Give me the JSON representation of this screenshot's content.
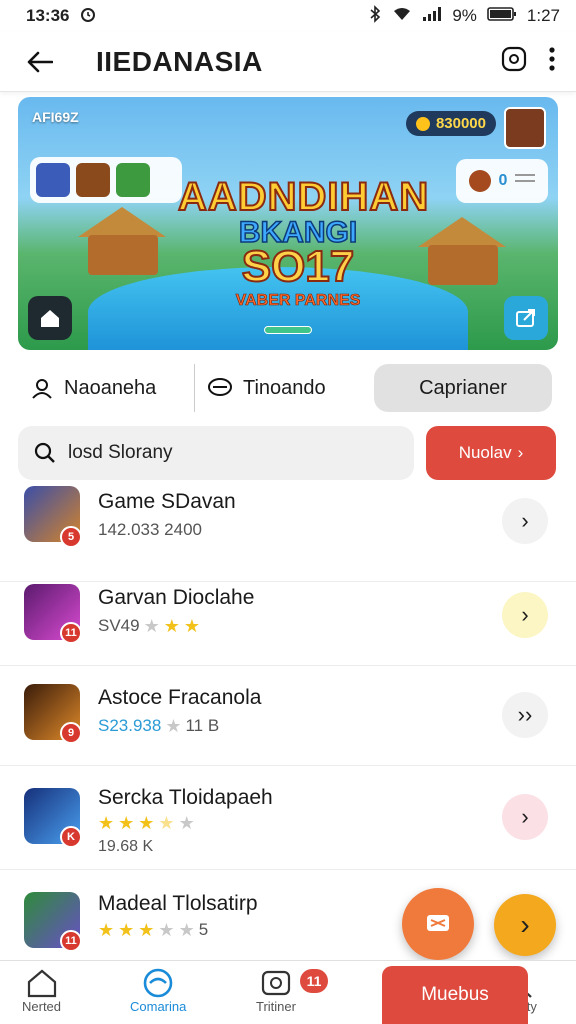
{
  "status_bar": {
    "time": "13:36",
    "battery": "9%",
    "right_time": "1:27"
  },
  "app_bar": {
    "title": "IIEDANASIA"
  },
  "banner": {
    "tag": "AFI69Z",
    "coins": "830000",
    "right_pill_count": "0",
    "logo_line1": "AADNDIHAN",
    "logo_line2": "BKANGI",
    "logo_line3": "SO17",
    "logo_line4": "VABER PARNES"
  },
  "tabs": [
    {
      "label": "Naoaneha"
    },
    {
      "label": "Tinoando"
    },
    {
      "label": "Caprianer"
    }
  ],
  "search": {
    "value": "losd Slorany",
    "filter_label": "Nuolav"
  },
  "games": [
    {
      "name": "Game SDavan",
      "meta": "142.033 2400",
      "badge": "5",
      "colors": [
        "#3a4ea8",
        "#d4842a"
      ],
      "go_color": "#f2f2f2"
    },
    {
      "name": "Garvan Dioclahe",
      "meta": "SV49",
      "rating": 3,
      "badge": "11",
      "colors": [
        "#5b1a6e",
        "#d94bd1"
      ],
      "go_color": "#fbf6c4"
    },
    {
      "name": "Astoce Fracanola",
      "meta": "S23.938",
      "meta2": "11 B",
      "badge": "9",
      "colors": [
        "#3a1c0a",
        "#e08a2a"
      ],
      "go_color": "#f2f2f2"
    },
    {
      "name": "Sercka Tloidapaeh",
      "meta": "19.68 K",
      "rating": 3,
      "badge": "K",
      "colors": [
        "#16307a",
        "#4aa0f0"
      ],
      "go_color": "#fbe0e6"
    },
    {
      "name": "Madeal Tlolsatirp",
      "meta": "5",
      "rating": 3,
      "badge": "11",
      "colors": [
        "#2e8b3a",
        "#6a4fc8"
      ],
      "go_color": "#f2f2f2"
    }
  ],
  "bottom_nav": {
    "items": [
      {
        "label": "Nerted"
      },
      {
        "label": "Comarina"
      },
      {
        "label": "Tritiner"
      },
      {
        "label": "Clenty"
      }
    ],
    "badge": "11",
    "cta_label": "Muebus"
  }
}
